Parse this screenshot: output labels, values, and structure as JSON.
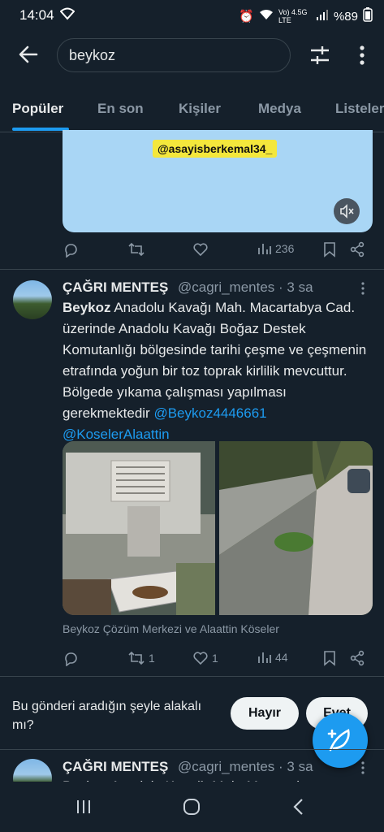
{
  "status": {
    "time": "14:04",
    "network": "Vo) 4.5G LTE",
    "battery": "%89"
  },
  "search": {
    "query": "beykoz"
  },
  "tabs": [
    {
      "label": "Popüler",
      "active": true
    },
    {
      "label": "En son"
    },
    {
      "label": "Kişiler"
    },
    {
      "label": "Medya"
    },
    {
      "label": "Listeler"
    }
  ],
  "video_post": {
    "overlay_tag": "@asayisberkemal34_",
    "actions": {
      "views": "236"
    }
  },
  "tweet": {
    "name": "ÇAĞRI MENTEŞ",
    "handle": "@cagri_mentes · 3 sa",
    "text_bold": "Beykoz",
    "text_body": " Anadolu Kavağı Mah. Macartabya Cad. üzerinde Anadolu Kavağı Boğaz Destek Komutanlığı bölgesinde tarihi çeşme ve çeşmenin etrafında yoğun bir toz toprak kirlilik mevcuttur. Bölgede yıkama çalışması yapılması gerekmektedir ",
    "mention1": "@Beykoz4446661",
    "mention2": "@KoselerAlaattin",
    "caption": "Beykoz Çözüm Merkezi ve Alaattin Köseler",
    "actions": {
      "retweets": "1",
      "likes": "1",
      "views": "44"
    }
  },
  "prompt": {
    "question": "Bu gönderi aradığın şeyle alakalı mı?",
    "no": "Hayır",
    "yes": "Evet"
  },
  "next_tweet": {
    "name": "ÇAĞRI MENTEŞ",
    "handle": "@cagri_mentes · 3 sa",
    "preview": "Beykoz Anadolu Kavağı Mah. Macartabya"
  },
  "colors": {
    "background": "#15202b",
    "accent": "#1d9bf0",
    "secondary_text": "#8b98a5"
  }
}
